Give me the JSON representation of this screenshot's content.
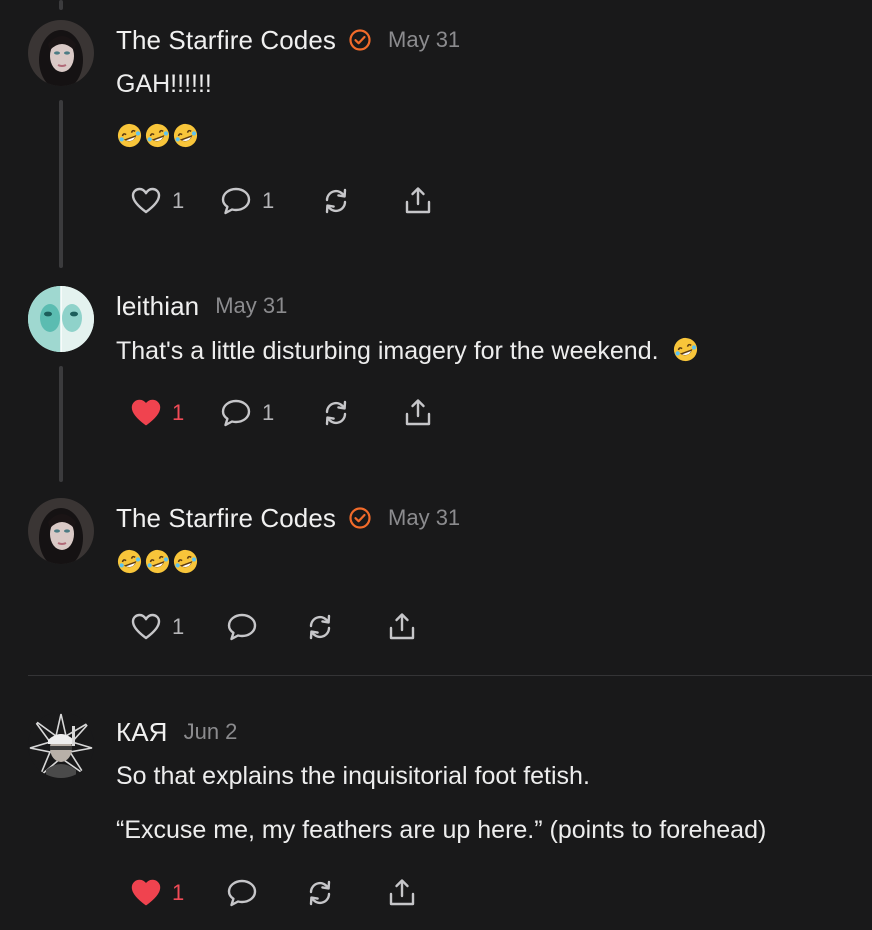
{
  "comments": [
    {
      "author": "The Starfire Codes",
      "verified": true,
      "date": "May 31",
      "lines": [
        "GAH!!!!!!"
      ],
      "emoji": [
        "rolling-on-floor-laughing",
        "rolling-on-floor-laughing",
        "rolling-on-floor-laughing"
      ],
      "likes": "1",
      "liked": false,
      "replies": "1"
    },
    {
      "author": "leithian",
      "verified": false,
      "date": "May 31",
      "lines": [
        "That's a little disturbing imagery for the weekend."
      ],
      "inline_emoji": "rolling-on-floor-laughing",
      "likes": "1",
      "liked": true,
      "replies": "1"
    },
    {
      "author": "The Starfire Codes",
      "verified": true,
      "date": "May 31",
      "emoji": [
        "rolling-on-floor-laughing",
        "rolling-on-floor-laughing",
        "rolling-on-floor-laughing"
      ],
      "likes": "1",
      "liked": false,
      "replies": ""
    },
    {
      "author": "КАЯ",
      "verified": false,
      "date": "Jun 2",
      "lines": [
        "So that explains the inquisitorial foot fetish.",
        "“Excuse me, my feathers are up here.” (points to forehead)"
      ],
      "likes": "1",
      "liked": true,
      "replies": ""
    }
  ],
  "icons": {
    "like": "heart-icon",
    "reply": "comment-bubble-icon",
    "restack": "restack-icon",
    "share": "share-icon",
    "verified": "verified-check-icon"
  },
  "colors": {
    "background": "#19191a",
    "accent": "#f26b2a",
    "liked": "#f0434f",
    "muted": "#8b8b8e"
  }
}
